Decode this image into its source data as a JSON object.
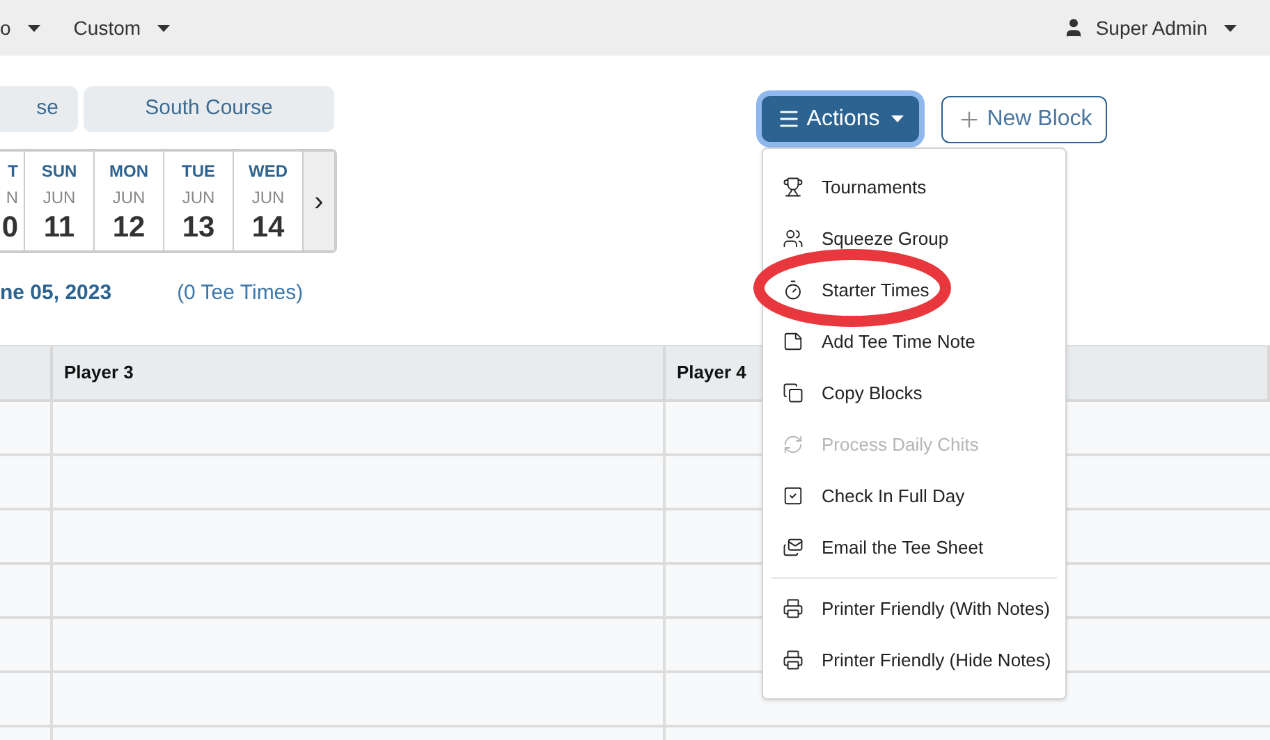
{
  "nav": {
    "items": [
      {
        "label": "o"
      },
      {
        "label": "Custom"
      }
    ],
    "user": "Super Admin"
  },
  "course_tabs": [
    {
      "label": "se",
      "selected": false
    },
    {
      "label": "South Course",
      "selected": false
    }
  ],
  "days": [
    {
      "weekday": "T",
      "month": "N",
      "day": "0"
    },
    {
      "weekday": "SUN",
      "month": "JUN",
      "day": "11"
    },
    {
      "weekday": "MON",
      "month": "JUN",
      "day": "12"
    },
    {
      "weekday": "TUE",
      "month": "JUN",
      "day": "13"
    },
    {
      "weekday": "WED",
      "month": "JUN",
      "day": "14"
    }
  ],
  "next_arrow": "›",
  "date_title": "ne 05, 2023",
  "tee_time_count": "(0 Tee Times)",
  "actions_button": {
    "label": "Actions",
    "expanded": true
  },
  "new_block_button": {
    "label": "New Block"
  },
  "menu": [
    {
      "kind": "trophy",
      "label": "Tournaments",
      "disabled": false,
      "circled": false
    },
    {
      "kind": "group",
      "label": "Squeeze Group",
      "disabled": false,
      "circled": false
    },
    {
      "kind": "stopwatch",
      "label": "Starter Times",
      "disabled": false,
      "circled": true
    },
    {
      "kind": "note",
      "label": "Add Tee Time Note",
      "disabled": false,
      "circled": false
    },
    {
      "kind": "copy",
      "label": "Copy Blocks",
      "disabled": false,
      "circled": false
    },
    {
      "kind": "refresh",
      "label": "Process Daily Chits",
      "disabled": true,
      "circled": false
    },
    {
      "kind": "check",
      "label": "Check In Full Day",
      "disabled": false,
      "circled": false
    },
    {
      "kind": "email",
      "label": "Email the Tee Sheet",
      "disabled": false,
      "circled": false
    },
    {
      "kind": "divider"
    },
    {
      "kind": "printer",
      "label": "Printer Friendly (With Notes)",
      "disabled": false,
      "circled": false
    },
    {
      "kind": "printer",
      "label": "Printer Friendly (Hide Notes)",
      "disabled": false,
      "circled": false
    }
  ],
  "table": {
    "columns": [
      "Player 3",
      "Player 4"
    ]
  }
}
